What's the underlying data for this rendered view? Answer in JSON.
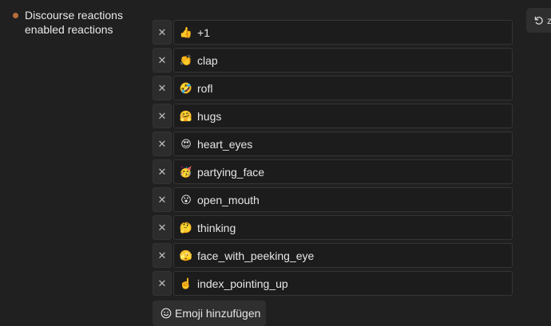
{
  "setting": {
    "label_line1": "Discourse reactions",
    "label_line2": "enabled reactions"
  },
  "revert": {
    "icon": "undo-icon",
    "extra": "z"
  },
  "reactions": [
    {
      "emoji": "👍",
      "value": "+1"
    },
    {
      "emoji": "👏",
      "value": "clap"
    },
    {
      "emoji": "🤣",
      "value": "rofl"
    },
    {
      "emoji": "🤗",
      "value": "hugs"
    },
    {
      "emoji": "😍",
      "value": "heart_eyes"
    },
    {
      "emoji": "🥳",
      "value": "partying_face"
    },
    {
      "emoji": "😮",
      "value": "open_mouth"
    },
    {
      "emoji": "🤔",
      "value": "thinking"
    },
    {
      "emoji": "🫣",
      "value": "face_with_peeking_eye"
    },
    {
      "emoji": "☝️",
      "value": "index_pointing_up"
    }
  ],
  "remove_label": "✕",
  "add_button": {
    "label": "Emoji hinzufügen",
    "icon": "smile-icon"
  },
  "colors": {
    "accent_dot": "#b86d3a",
    "background": "#202020"
  }
}
